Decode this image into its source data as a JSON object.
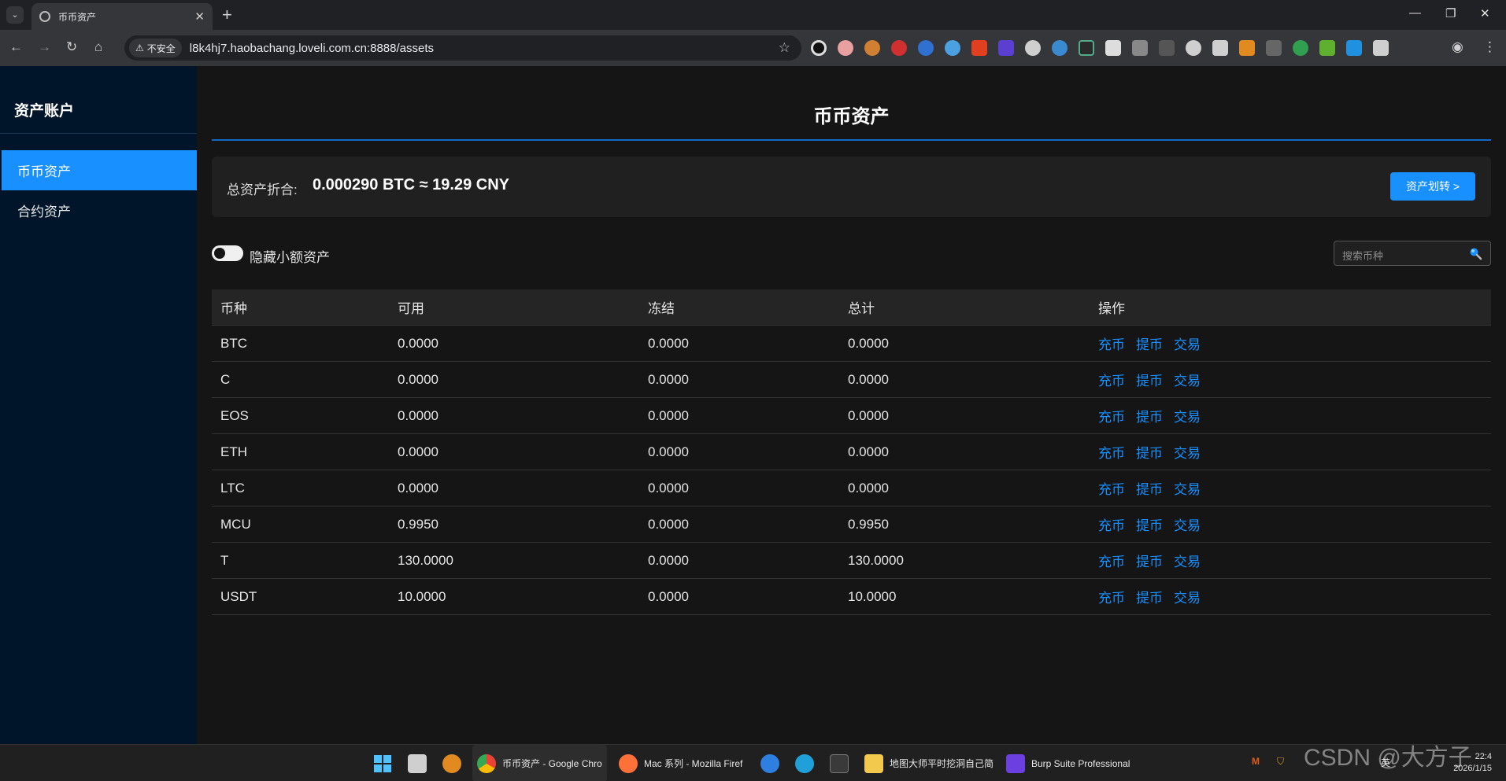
{
  "browser": {
    "tab_title": "币币资产",
    "insecure_label": "不安全",
    "url": "l8k4hj7.haobachang.loveli.com.cn:8888/assets"
  },
  "sidebar": {
    "title": "资产账户",
    "items": [
      {
        "label": "币币资产",
        "active": true
      },
      {
        "label": "合约资产",
        "active": false
      }
    ]
  },
  "main": {
    "page_title": "币币资产",
    "summary": {
      "label": "总资产折合:",
      "value": "0.000290 BTC ≈ 19.29 CNY",
      "transfer_label": "资产划转 >"
    },
    "hide_small_label": "隐藏小额资产",
    "search_placeholder": "搜索币种",
    "table": {
      "headers": [
        "币种",
        "可用",
        "冻结",
        "总计",
        "操作"
      ],
      "actions": [
        "充币",
        "提币",
        "交易"
      ],
      "rows": [
        {
          "coin": "BTC",
          "available": "0.0000",
          "frozen": "0.0000",
          "total": "0.0000"
        },
        {
          "coin": "C",
          "available": "0.0000",
          "frozen": "0.0000",
          "total": "0.0000"
        },
        {
          "coin": "EOS",
          "available": "0.0000",
          "frozen": "0.0000",
          "total": "0.0000"
        },
        {
          "coin": "ETH",
          "available": "0.0000",
          "frozen": "0.0000",
          "total": "0.0000"
        },
        {
          "coin": "LTC",
          "available": "0.0000",
          "frozen": "0.0000",
          "total": "0.0000"
        },
        {
          "coin": "MCU",
          "available": "0.9950",
          "frozen": "0.0000",
          "total": "0.9950"
        },
        {
          "coin": "T",
          "available": "130.0000",
          "frozen": "0.0000",
          "total": "130.0000"
        },
        {
          "coin": "USDT",
          "available": "10.0000",
          "frozen": "0.0000",
          "total": "10.0000"
        }
      ]
    }
  },
  "taskbar": {
    "items": [
      {
        "label": "币币资产 - Google Chro"
      },
      {
        "label": "Mac 系列 - Mozilla Firef"
      },
      {
        "label": "地图大师平时挖洞自己简"
      },
      {
        "label": "Burp Suite Professional"
      }
    ],
    "clock_time": "22:4",
    "clock_date": "2026/1/15",
    "ime": "英"
  },
  "watermark": "CSDN @大方子",
  "colors": {
    "accent": "#1890ff",
    "sidebar_bg": "#001529",
    "page_bg": "#151515"
  }
}
